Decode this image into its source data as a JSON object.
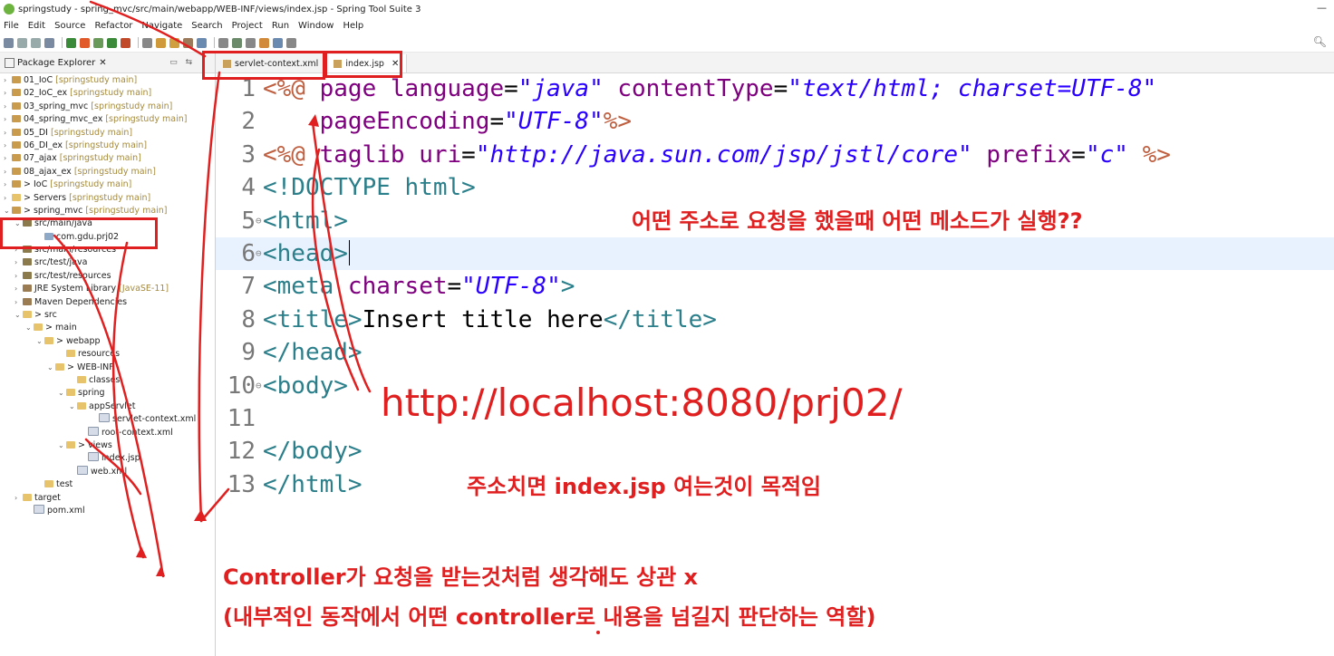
{
  "window": {
    "title": "springstudy - spring_mvc/src/main/webapp/WEB-INF/views/index.jsp - Spring Tool Suite 3",
    "minimize_glyph": "—"
  },
  "menu": [
    "File",
    "Edit",
    "Source",
    "Refactor",
    "Navigate",
    "Search",
    "Project",
    "Run",
    "Window",
    "Help"
  ],
  "explorer": {
    "title": "Package Explorer",
    "close": "✕",
    "items": [
      {
        "arrow": "›",
        "icon": "proj",
        "label": "01_IoC",
        "ann": " [springstudy main]",
        "indent": 0
      },
      {
        "arrow": "›",
        "icon": "proj",
        "label": "02_IoC_ex",
        "ann": " [springstudy main]",
        "indent": 0
      },
      {
        "arrow": "›",
        "icon": "proj",
        "label": "03_spring_mvc",
        "ann": " [springstudy main]",
        "indent": 0
      },
      {
        "arrow": "›",
        "icon": "proj",
        "label": "04_spring_mvc_ex",
        "ann": " [springstudy main]",
        "indent": 0
      },
      {
        "arrow": "›",
        "icon": "proj",
        "label": "05_DI",
        "ann": " [springstudy main]",
        "indent": 0
      },
      {
        "arrow": "›",
        "icon": "proj",
        "label": "06_DI_ex",
        "ann": " [springstudy main]",
        "indent": 0
      },
      {
        "arrow": "›",
        "icon": "proj",
        "label": "07_ajax",
        "ann": " [springstudy main]",
        "indent": 0
      },
      {
        "arrow": "›",
        "icon": "proj",
        "label": "08_ajax_ex",
        "ann": " [springstudy main]",
        "indent": 0
      },
      {
        "arrow": "›",
        "icon": "proj",
        "label": "> IoC",
        "ann": " [springstudy main]",
        "indent": 0
      },
      {
        "arrow": "›",
        "icon": "folder",
        "label": "> Servers",
        "ann": " [springstudy main]",
        "indent": 0
      },
      {
        "arrow": "⌄",
        "icon": "proj",
        "label": "> spring_mvc",
        "ann": " [springstudy main]",
        "indent": 0
      },
      {
        "arrow": "⌄",
        "icon": "src",
        "label": "src/main/java",
        "ann": "",
        "indent": 1
      },
      {
        "arrow": "",
        "icon": "pkg",
        "label": "com.gdu.prj02",
        "ann": "",
        "indent": 3
      },
      {
        "arrow": "›",
        "icon": "src",
        "label": "src/main/resources",
        "ann": "",
        "indent": 1
      },
      {
        "arrow": "›",
        "icon": "src",
        "label": "src/test/java",
        "ann": "",
        "indent": 1
      },
      {
        "arrow": "›",
        "icon": "src",
        "label": "src/test/resources",
        "ann": "",
        "indent": 1
      },
      {
        "arrow": "›",
        "icon": "lib",
        "label": "JRE System Library",
        "ann": " [JavaSE-11]",
        "indent": 1
      },
      {
        "arrow": "›",
        "icon": "lib",
        "label": "Maven Dependencies",
        "ann": "",
        "indent": 1
      },
      {
        "arrow": "⌄",
        "icon": "folder",
        "label": "> src",
        "ann": "",
        "indent": 1
      },
      {
        "arrow": "⌄",
        "icon": "folder",
        "label": "> main",
        "ann": "",
        "indent": 2
      },
      {
        "arrow": "⌄",
        "icon": "folder",
        "label": "> webapp",
        "ann": "",
        "indent": 3
      },
      {
        "arrow": "",
        "icon": "folder",
        "label": "resources",
        "ann": "",
        "indent": 5
      },
      {
        "arrow": "⌄",
        "icon": "folder",
        "label": "> WEB-INF",
        "ann": "",
        "indent": 4
      },
      {
        "arrow": "",
        "icon": "folder",
        "label": "classes",
        "ann": "",
        "indent": 6
      },
      {
        "arrow": "⌄",
        "icon": "folder",
        "label": "spring",
        "ann": "",
        "indent": 5
      },
      {
        "arrow": "⌄",
        "icon": "folder",
        "label": "appServlet",
        "ann": "",
        "indent": 6
      },
      {
        "arrow": "",
        "icon": "file",
        "label": "servlet-context.xml",
        "ann": "",
        "indent": 8
      },
      {
        "arrow": "",
        "icon": "file",
        "label": "root-context.xml",
        "ann": "",
        "indent": 7
      },
      {
        "arrow": "⌄",
        "icon": "folder",
        "label": "> views",
        "ann": "",
        "indent": 5
      },
      {
        "arrow": "",
        "icon": "file",
        "label": "index.jsp",
        "ann": "",
        "indent": 7
      },
      {
        "arrow": "",
        "icon": "file",
        "label": "web.xml",
        "ann": "",
        "indent": 6
      },
      {
        "arrow": "",
        "icon": "folder",
        "label": "test",
        "ann": "",
        "indent": 3
      },
      {
        "arrow": "›",
        "icon": "folder",
        "label": "target",
        "ann": "",
        "indent": 1
      },
      {
        "arrow": "",
        "icon": "file",
        "label": "pom.xml",
        "ann": "",
        "indent": 2
      }
    ]
  },
  "tabs": [
    {
      "label": "servlet-context.xml",
      "active": false
    },
    {
      "label": "index.jsp",
      "active": true,
      "close": "✕"
    }
  ],
  "code": [
    {
      "n": "1",
      "fold": "",
      "parts": [
        [
          "dir",
          "<%@ "
        ],
        [
          "attr",
          "page "
        ],
        [
          "attr",
          "language"
        ],
        [
          "txt",
          "="
        ],
        [
          "str",
          "\"java\""
        ],
        [
          "txt",
          " "
        ],
        [
          "attr",
          "contentType"
        ],
        [
          "txt",
          "="
        ],
        [
          "str",
          "\"text/html; charset=UTF-8\""
        ]
      ]
    },
    {
      "n": "2",
      "fold": "",
      "parts": [
        [
          "txt",
          "    "
        ],
        [
          "attr",
          "pageEncoding"
        ],
        [
          "txt",
          "="
        ],
        [
          "str",
          "\"UTF-8\""
        ],
        [
          "dir",
          "%>"
        ]
      ]
    },
    {
      "n": "3",
      "fold": "",
      "parts": [
        [
          "dir",
          "<%@ "
        ],
        [
          "attr",
          "taglib "
        ],
        [
          "attr",
          "uri"
        ],
        [
          "txt",
          "="
        ],
        [
          "str",
          "\"http://java.sun.com/jsp/jstl/core\""
        ],
        [
          "txt",
          " "
        ],
        [
          "attr",
          "prefix"
        ],
        [
          "txt",
          "="
        ],
        [
          "str",
          "\"c\""
        ],
        [
          "txt",
          " "
        ],
        [
          "dir",
          "%>"
        ]
      ]
    },
    {
      "n": "4",
      "fold": "",
      "parts": [
        [
          "tag",
          "<!DOCTYPE html>"
        ]
      ]
    },
    {
      "n": "5",
      "fold": "⊖",
      "parts": [
        [
          "tag",
          "<html>"
        ]
      ]
    },
    {
      "n": "6",
      "fold": "⊖",
      "current": true,
      "parts": [
        [
          "tag",
          "<head>"
        ]
      ]
    },
    {
      "n": "7",
      "fold": "",
      "parts": [
        [
          "tag",
          "<meta "
        ],
        [
          "attr",
          "charset"
        ],
        [
          "txt",
          "="
        ],
        [
          "str",
          "\"UTF-8\""
        ],
        [
          "tag",
          ">"
        ]
      ]
    },
    {
      "n": "8",
      "fold": "",
      "parts": [
        [
          "tag",
          "<title>"
        ],
        [
          "txt",
          "Insert title here"
        ],
        [
          "tag",
          "</title>"
        ]
      ]
    },
    {
      "n": "9",
      "fold": "",
      "parts": [
        [
          "tag",
          "</head>"
        ]
      ]
    },
    {
      "n": "10",
      "fold": "⊖",
      "parts": [
        [
          "tag",
          "<body>"
        ]
      ]
    },
    {
      "n": "11",
      "fold": "",
      "parts": []
    },
    {
      "n": "12",
      "fold": "",
      "parts": [
        [
          "tag",
          "</body>"
        ]
      ]
    },
    {
      "n": "13",
      "fold": "",
      "parts": [
        [
          "tag",
          "</html>"
        ]
      ]
    }
  ],
  "annotations": {
    "question": "어떤 주소로 요청을 했을때 어떤 메소드가 실행??",
    "url": "http://localhost:8080/prj02/",
    "purpose": "주소치면 index.jsp 여는것이 목적임",
    "controller_line1": "Controller가 요청을 받는것처럼 생각해도 상관 x",
    "controller_line2": "(내부적인 동작에서 어떤 controller로 내용을 넘길지 판단하는 역할)"
  },
  "colors": {
    "annotation_red": "#e02020",
    "line_highlight": "#e8f2fe"
  }
}
